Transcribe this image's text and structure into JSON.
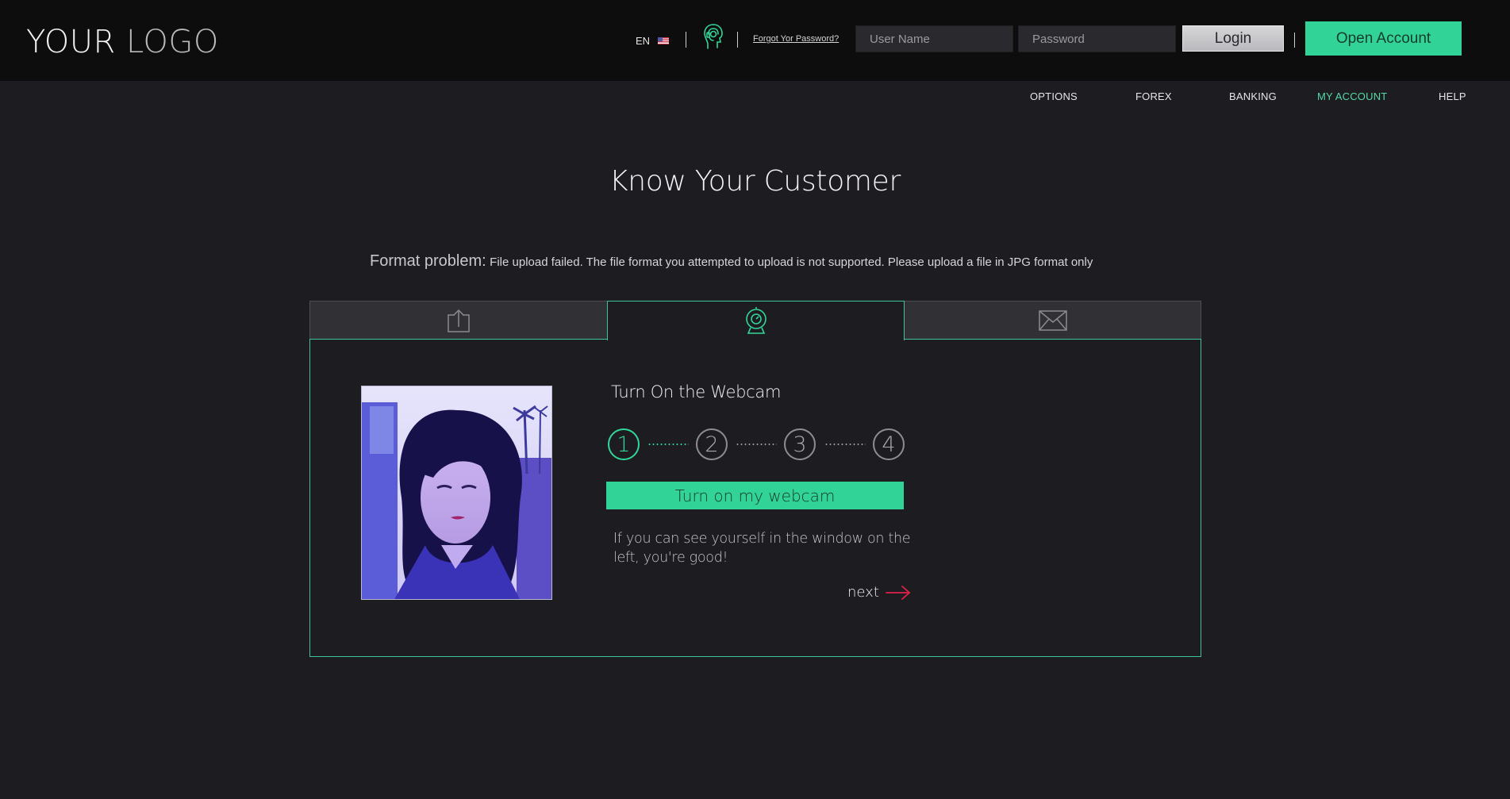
{
  "header": {
    "logo_part1": "YOUR",
    "logo_part2": "LOGO",
    "language": "EN",
    "forgot_password": "Forgot Yor Password?",
    "username_placeholder": "User Name",
    "password_placeholder": "Password",
    "login_label": "Login",
    "open_account_label": "Open Account"
  },
  "nav": {
    "items": [
      {
        "label": "OPTIONS"
      },
      {
        "label": "FOREX"
      },
      {
        "label": "BANKING"
      },
      {
        "label": "MY ACCOUNT"
      },
      {
        "label": "HELP"
      }
    ],
    "active": "MY ACCOUNT"
  },
  "main": {
    "title": "Know Your Customer",
    "error_label": "Format problem:",
    "error_message": "File upload failed. The file format you attempted to upload is not supported. Please upload a file in JPG format only",
    "tabs": [
      {
        "icon": "upload-icon"
      },
      {
        "icon": "webcam-icon",
        "active": true
      },
      {
        "icon": "envelope-icon"
      }
    ],
    "step_title": "Turn On the Webcam",
    "steps": [
      "1",
      "2",
      "3",
      "4"
    ],
    "current_step": 1,
    "webcam_button": "Turn on my webcam",
    "hint": "If you can see yourself in the window on the left, you're good!",
    "next_label": "next"
  },
  "colors": {
    "accent": "#32d396",
    "header_bg": "#0d0d0e",
    "page_bg": "#1c1c21",
    "next_arrow": "#e0214a"
  }
}
